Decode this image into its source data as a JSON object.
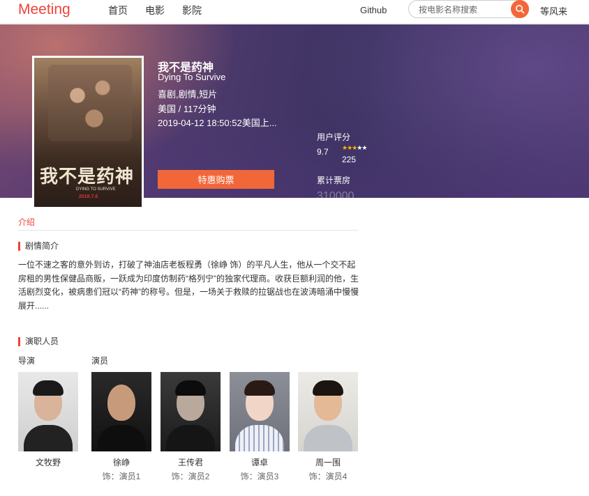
{
  "header": {
    "logo": "Meeting",
    "nav": [
      "首页",
      "电影",
      "影院"
    ],
    "github": "Github",
    "search_placeholder": "按电影名称搜索",
    "user": "等风来"
  },
  "movie": {
    "title": "我不是药神",
    "title_en": "Dying To Survive",
    "genres": "喜剧,剧情,短片",
    "country_duration": "美国 / 117分钟",
    "release": "2019-04-12 18:50:52美国上...",
    "buy_label": "特惠购票",
    "poster_title": "我不是药神",
    "poster_subtitle": "DYING TO SURVIVE",
    "poster_date": "2018.7.6",
    "rating": {
      "label": "用户评分",
      "score": "9.7",
      "stars_filled": 3,
      "stars_total": 5,
      "count": "225"
    },
    "box_office": {
      "label": "累计票房",
      "value": "310000"
    }
  },
  "tabs": {
    "intro": "介绍"
  },
  "sections": {
    "plot_title": "剧情简介",
    "plot": "一位不速之客的意外到访，打破了神油店老板程勇（徐峥 饰）的平凡人生，他从一个交不起房租的男性保健品商贩，一跃成为印度仿制药“格列宁”的独家代理商。收获巨额利润的他，生活剧烈变化，被病患们冠以“药神”的称号。但是，一场关于救赎的拉锯战也在波涛暗涌中慢慢展开......",
    "cast_title": "演职人员",
    "director_label": "导演",
    "actor_label": "演员"
  },
  "cast": [
    {
      "name": "文牧野",
      "role": ""
    },
    {
      "name": "徐峥",
      "role": "饰：演员1"
    },
    {
      "name": "王传君",
      "role": "饰：演员2"
    },
    {
      "name": "谭卓",
      "role": "饰：演员3"
    },
    {
      "name": "周一围",
      "role": "饰：演员4"
    }
  ],
  "colors": {
    "accent": "#ef4238",
    "button": "#f2673a",
    "star": "#ffb400"
  }
}
